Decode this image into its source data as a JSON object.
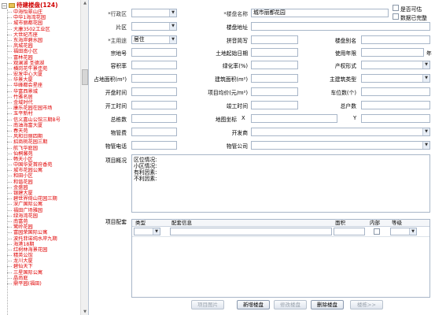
{
  "tree": {
    "root_label": "待建楼盘(124)",
    "items": [
      "中海怡翠山庄",
      "中华1海湾花园",
      "城市丽都花园",
      "大康3502工业区",
      "大世纪杰座",
      "东海岸碧水园",
      "凤城花园",
      "福田南小区",
      "富林花园",
      "观澜湖 圣德湖",
      "横岗花牛景佳苑",
      "宏发中心大厦",
      "华景大厦",
      "华峰都会星座",
      "华富西景城",
      "竹雅名居",
      "金域时代",
      "康乐花园在园市场",
      "玉平新村",
      "信义嘉山公馆三期B号",
      "南油海富大厦",
      "春天苑",
      "风和日丽四期",
      "招商桃花园三期",
      "航飞华庭园",
      "仙桐馨苑",
      "畅天小区",
      "中国华夏首府香苑",
      "城市花园公寓",
      "和田小区",
      "和谐花园",
      "金盛园",
      "银建大厦",
      "碧世界倚山花园三期",
      "深广国际公寓",
      "福田广场雅园",
      "绿海湾花园",
      "南富苑",
      "鹭岭花园",
      "富园荣国际公寓",
      "波托菲诺纯水岸九期",
      "海港18期",
      "红树林海景花园",
      "精英公馆",
      "龙川大厦",
      "碧仙天下",
      "三星国际公寓",
      "晶尚庭",
      "鼎平园(福田)"
    ]
  },
  "form": {
    "district_label": "*行政区",
    "name_label": "*楼盘名称",
    "name_value": "城市丽都花园",
    "sellable_label": "是否可估",
    "complete_label": "数据已完整",
    "area_label": "片区",
    "address_label": "楼盘地址",
    "usage_label": "*主用途",
    "usage_value": "居住",
    "pinyin_label": "拼音简写",
    "alias_label": "楼盘别名",
    "parcel_label": "宗地号",
    "land_start_label": "土地起始日期",
    "use_years_label": "使用年限",
    "year_unit": "年",
    "plot_ratio_label": "容积率",
    "green_ratio_label": "绿化率(%)",
    "ownership_label": "产权形式",
    "land_area_label": "占地面积(m²)",
    "build_area_label": "建筑面积(m²)",
    "build_type_label": "主建筑类型",
    "open_time_label": "开盘时间",
    "avg_price_label": "项目均价(元/m²)",
    "parking_label": "车位数(个)",
    "start_time_label": "开工时间",
    "complete_time_label": "竣工时间",
    "households_label": "总户数",
    "buildings_label": "总栋数",
    "coord_label": "地图坐标",
    "coord_x": "X",
    "coord_y": "Y",
    "mgmt_fee_label": "物管费",
    "developer_label": "开发商",
    "mgmt_phone_label": "物管电话",
    "mgmt_company_label": "物管公司",
    "overview_label": "项目概况",
    "overview_text": [
      "区位情况:",
      "小区情况:",
      "有利因素:",
      "不利因素:"
    ],
    "facilities_label": "项目配套"
  },
  "grid": {
    "columns": [
      "类型",
      "配套信息",
      "面积",
      "内部",
      "等级"
    ]
  },
  "buttons": [
    "项目图片",
    "新增楼盘",
    "修改楼盘",
    "删除楼盘",
    "楼栋>>"
  ],
  "colors": {
    "tree_text": "#e00000",
    "accent_border": "#a8b6c8"
  }
}
